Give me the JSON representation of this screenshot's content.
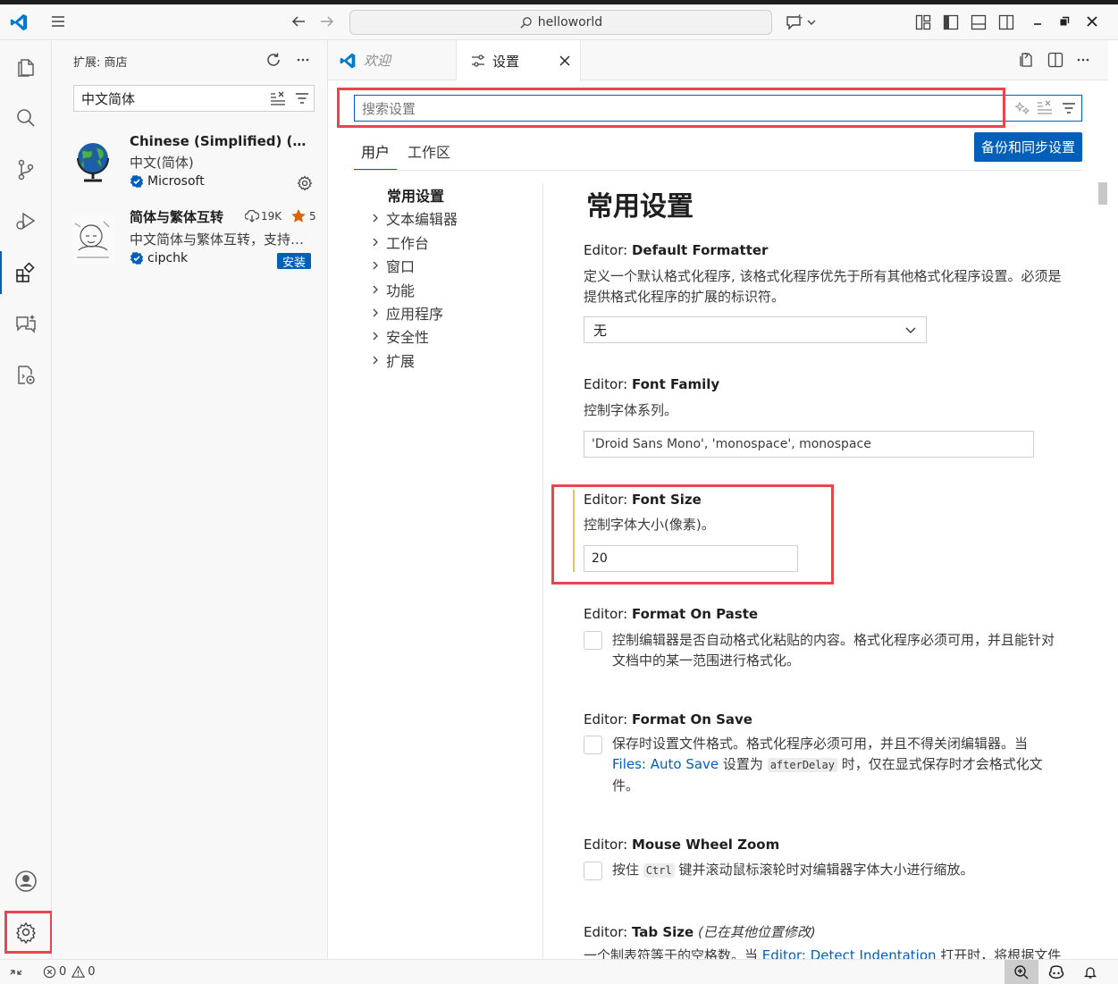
{
  "titlebar": {
    "search_text": "helloworld"
  },
  "sidebar": {
    "title": "扩展: 商店",
    "search_value": "中文简体",
    "extensions": [
      {
        "name": "Chinese (Simplified) (简体中文) Language Pack for Visual Studio Code",
        "description": "中文(简体)",
        "publisher": "Microsoft"
      },
      {
        "name": "简体与繁体互转",
        "downloads": "19K",
        "rating": "5",
        "description": "中文简体与繁体互转，支持多种转换方式",
        "publisher": "cipchk",
        "install_label": "安装"
      }
    ]
  },
  "tabs": {
    "welcome": "欢迎",
    "settings": "设置"
  },
  "settings": {
    "search_placeholder": "搜索设置",
    "scope_user": "用户",
    "scope_workspace": "工作区",
    "sync_button": "备份和同步设置",
    "toc": {
      "common": "常用设置",
      "items": [
        "文本编辑器",
        "工作台",
        "窗口",
        "功能",
        "应用程序",
        "安全性",
        "扩展"
      ]
    },
    "heading": "常用设置",
    "default_formatter": {
      "prefix": "Editor: ",
      "name": "Default Formatter",
      "description": "定义一个默认格式化程序, 该格式化程序优先于所有其他格式化程序设置。必须是提供格式化程序的扩展的标识符。",
      "value": "无"
    },
    "font_family": {
      "prefix": "Editor: ",
      "name": "Font Family",
      "description": "控制字体系列。",
      "value": "'Droid Sans Mono', 'monospace', monospace"
    },
    "font_size": {
      "prefix": "Editor: ",
      "name": "Font Size",
      "description": "控制字体大小(像素)。",
      "value": "20"
    },
    "format_on_paste": {
      "prefix": "Editor: ",
      "name": "Format On Paste",
      "description": "控制编辑器是否自动格式化粘贴的内容。格式化程序必须可用，并且能针对文档中的某一范围进行格式化。"
    },
    "format_on_save": {
      "prefix": "Editor: ",
      "name": "Format On Save",
      "desc_part1": "保存时设置文件格式。格式化程序必须可用，并且不得关闭编辑器。当 ",
      "link": "Files: Auto Save",
      "desc_part2": " 设置为 ",
      "code": "afterDelay",
      "desc_part3": " 时，仅在显式保存时才会格式化文件。"
    },
    "mouse_wheel_zoom": {
      "prefix": "Editor: ",
      "name": "Mouse Wheel Zoom",
      "desc_part1": "按住 ",
      "code": "Ctrl",
      "desc_part2": " 键并滚动鼠标滚轮时对编辑器字体大小进行缩放。"
    },
    "tab_size": {
      "prefix": "Editor: ",
      "name": "Tab Size",
      "modified_note": "(已在其他位置修改)",
      "desc_part1": "一个制表符等于的空格数。当 ",
      "link": "Editor: Detect Indentation",
      "desc_part2": " 打开时，将根据文件"
    }
  },
  "statusbar": {
    "errors": "0",
    "warnings": "0"
  },
  "colors": {
    "accent": "#005fb8",
    "highlight_box": "#e8464f"
  }
}
